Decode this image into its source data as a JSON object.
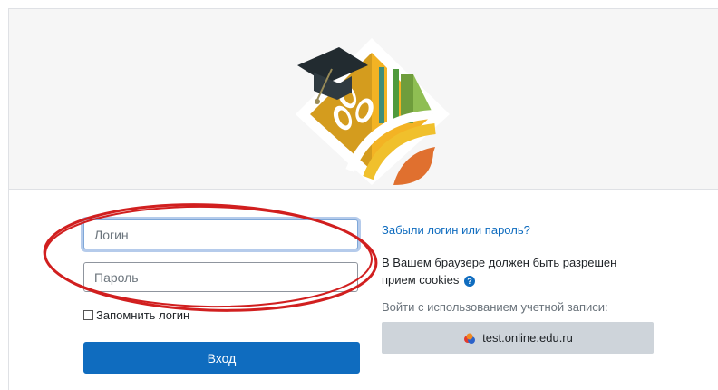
{
  "login_form": {
    "username_placeholder": "Логин",
    "password_placeholder": "Пароль",
    "remember_label": "Запомнить логин",
    "submit_label": "Вход"
  },
  "side_info": {
    "forgot_link": "Забыли логин или пароль?",
    "cookies_notice": "В Вашем браузере должен быть разрешен прием cookies",
    "sso_label": "Войти с использованием учетной записи:",
    "sso_button": "test.online.edu.ru"
  },
  "icons": {
    "help": "question-circle-icon",
    "sso": "online-edu-logo-icon",
    "logo": "graduation-cap-wheat-logo"
  },
  "colors": {
    "primary": "#0f6cbf",
    "annotation_ellipse": "#d11f1f",
    "logo_gold": "#d19a1c",
    "logo_green": "#6f9d3c",
    "logo_orange": "#e0702f",
    "logo_teal": "#3f8d7a"
  }
}
